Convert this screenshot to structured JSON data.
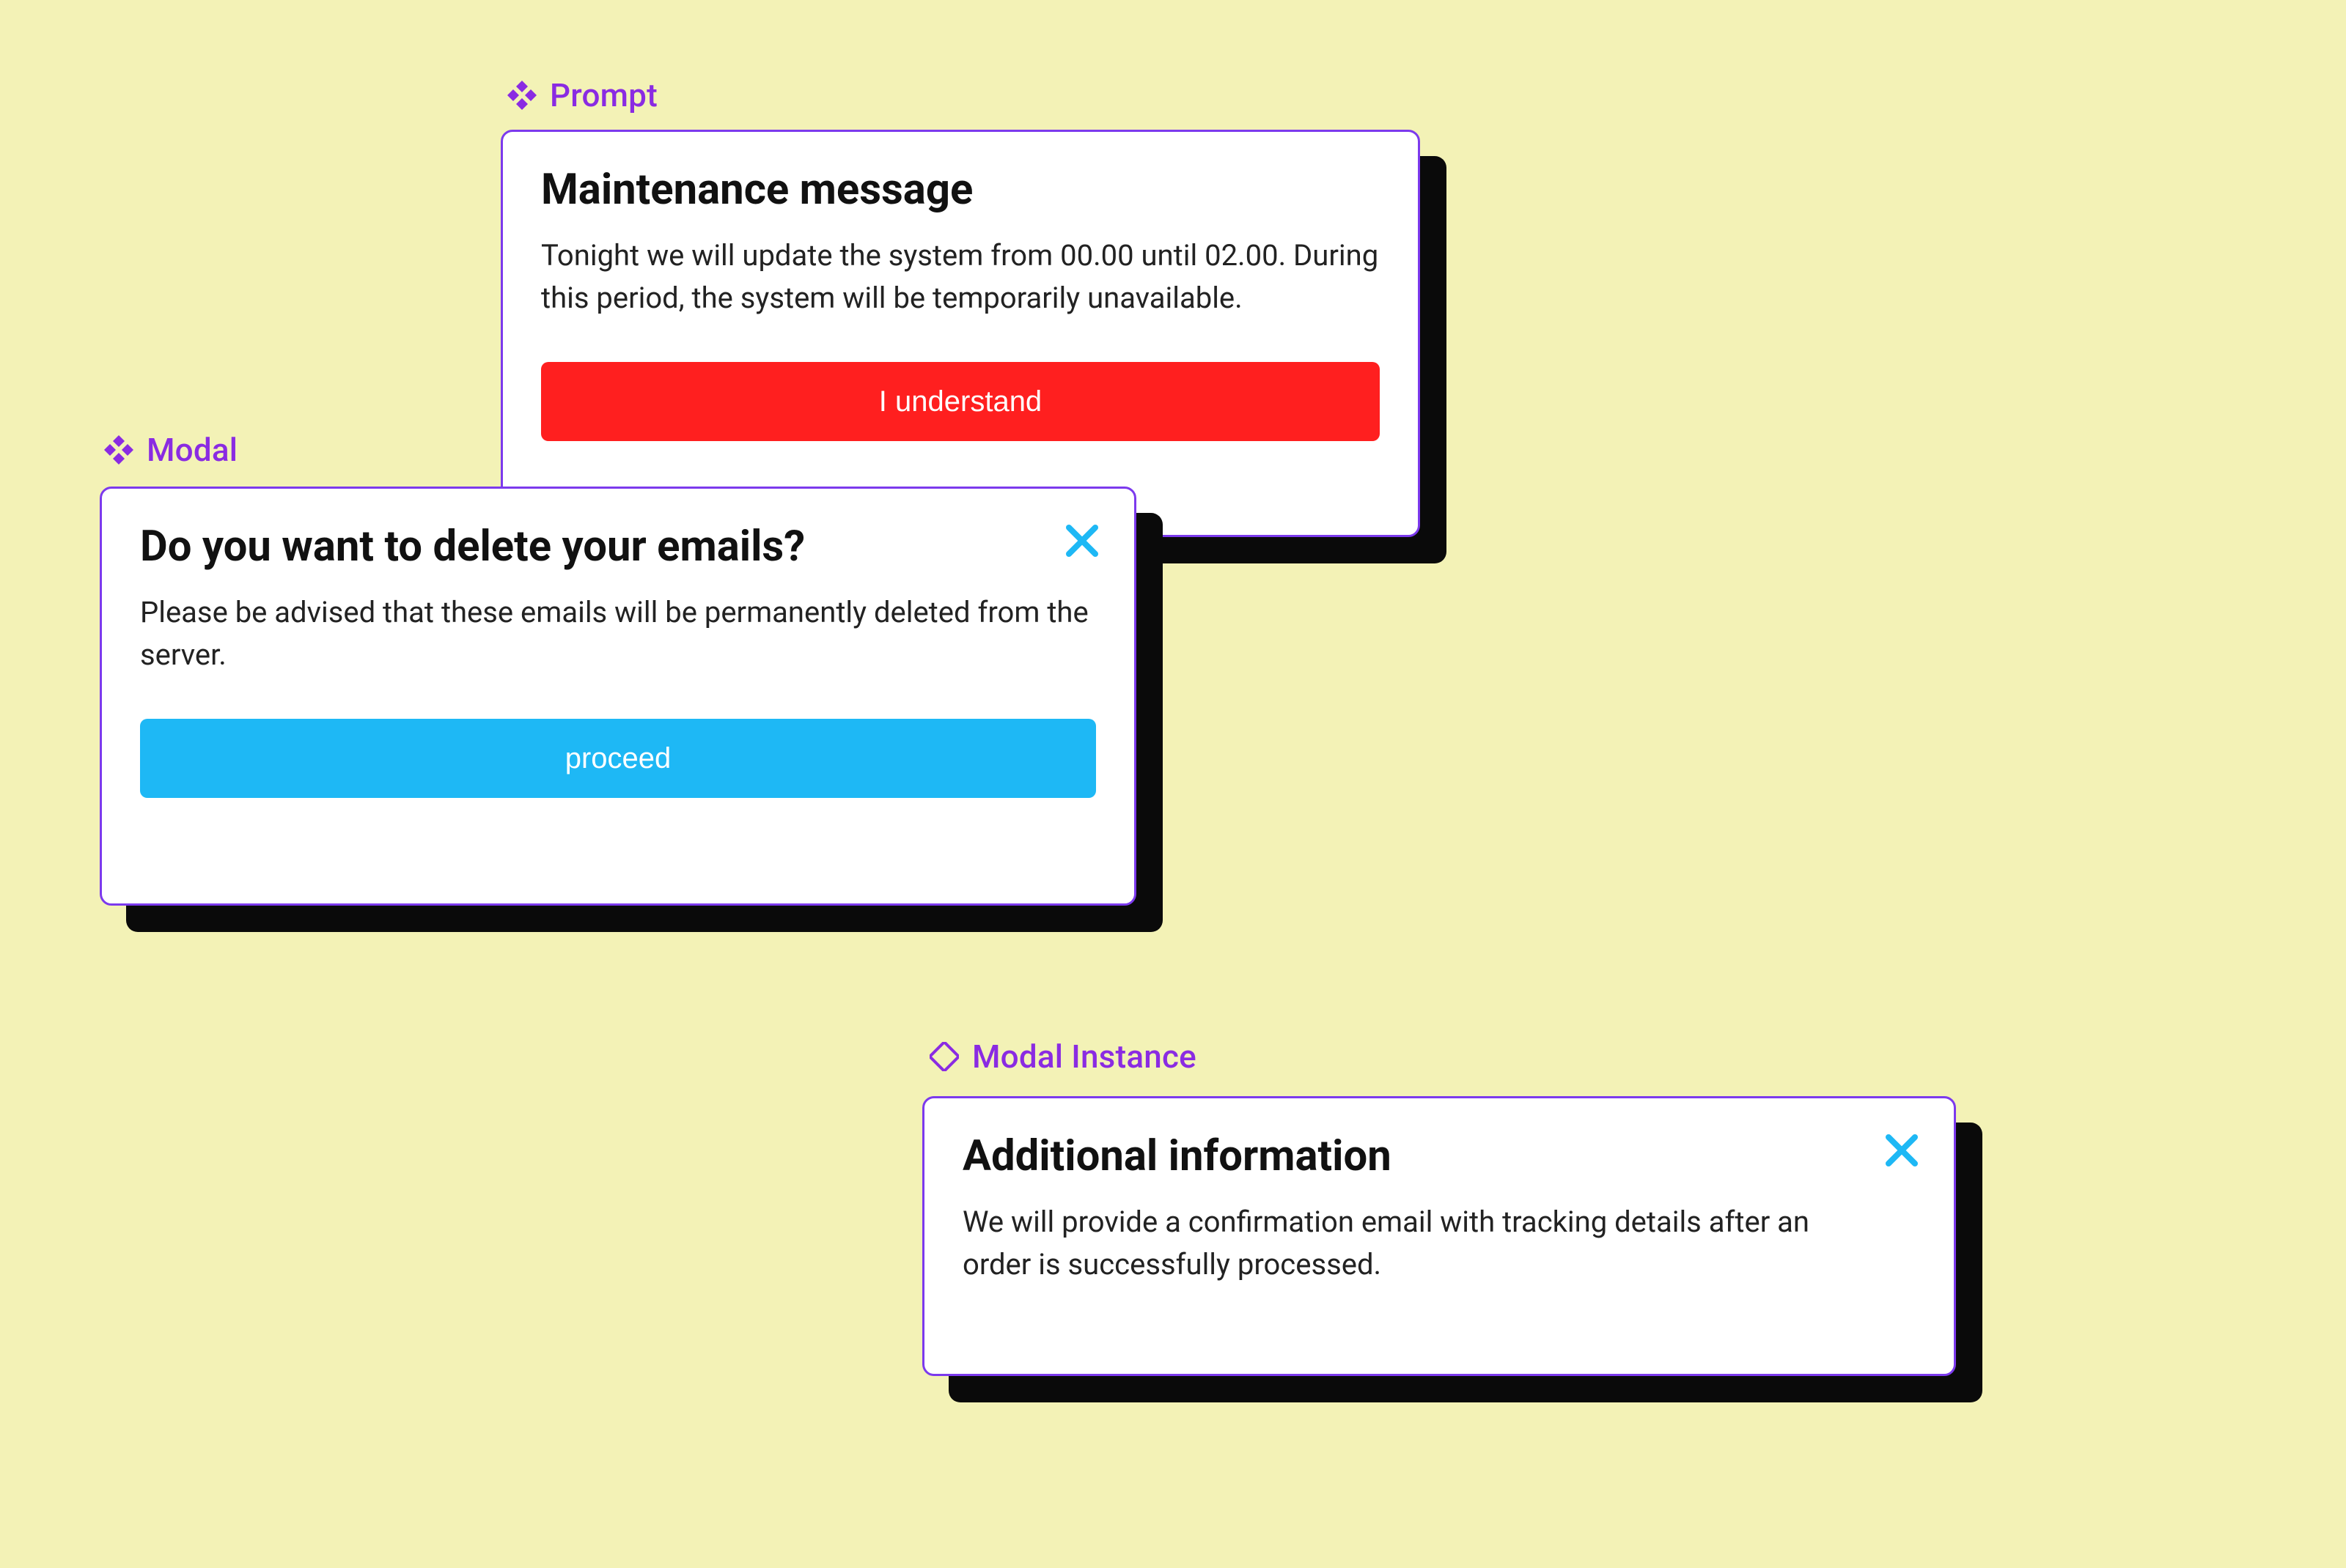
{
  "labels": {
    "prompt": "Prompt",
    "modal": "Modal",
    "modal_instance": "Modal Instance"
  },
  "prompt_card": {
    "title": "Maintenance message",
    "body": "Tonight we will update the system from 00.00 until 02.00. During this period, the system will be temporarily unavailable.",
    "button_label": "I understand"
  },
  "modal_card": {
    "title": "Do you want to delete your emails?",
    "body": "Please be advised that these emails will be permanently deleted from the server.",
    "button_label": "proceed"
  },
  "instance_card": {
    "title": "Additional information",
    "body": "We will provide a confirmation email with tracking details after an order is successfully processed."
  },
  "colors": {
    "accent_purple": "#8a2be2",
    "button_red": "#ff1f1f",
    "button_blue": "#1eb8f5",
    "card_border": "#7c3aed",
    "canvas_bg": "#f3f2b6",
    "shadow": "#0a0a0a"
  }
}
